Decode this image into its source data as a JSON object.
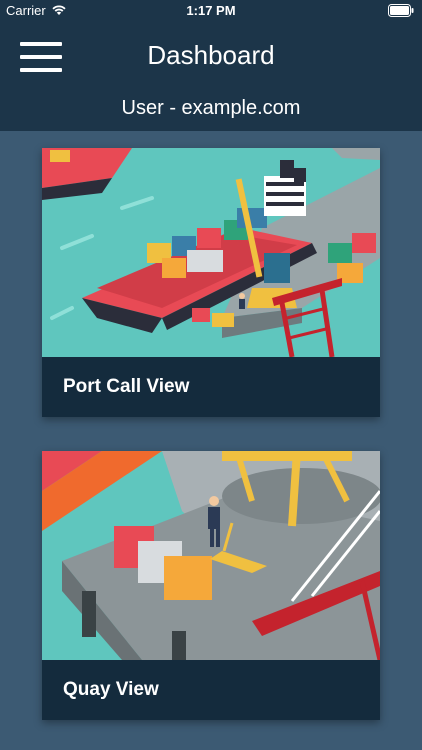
{
  "status_bar": {
    "carrier": "Carrier",
    "time": "1:17 PM"
  },
  "header": {
    "title": "Dashboard",
    "user": "User - example.com",
    "menu_icon": "hamburger-menu-icon"
  },
  "cards": [
    {
      "label": "Port Call View",
      "image": "container-ship-illustration"
    },
    {
      "label": "Quay View",
      "image": "quay-crane-illustration"
    }
  ],
  "colors": {
    "header_bg": "#1c3549",
    "page_bg": "#3c5a73",
    "card_footer_bg": "#142b3d",
    "water": "#5fc6be"
  }
}
